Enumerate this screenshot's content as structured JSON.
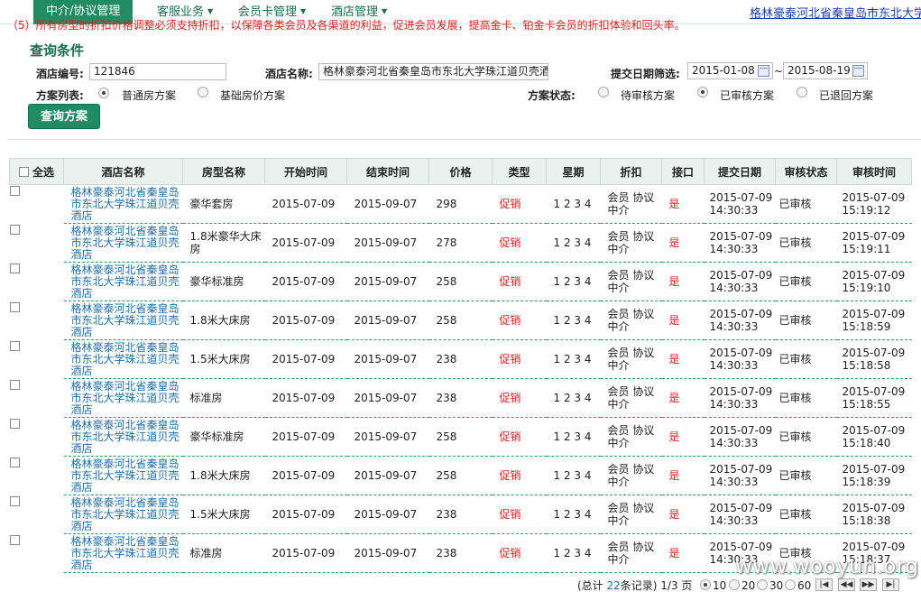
{
  "nav": {
    "items": [
      {
        "label": "中介/协议管理",
        "active": true
      },
      {
        "label": "客服业务",
        "active": false
      },
      {
        "label": "会员卡管理",
        "active": false
      },
      {
        "label": "酒店管理",
        "active": false
      }
    ],
    "hotel_link": "格林豪泰河北省秦皇岛市东北大学珠江道贝壳酒店"
  },
  "notice": "（5）所有房型的折扣价格调整必须支持折扣，以保障各类会员及各渠道的利益，促进会员发展，提高金卡、铂金卡会员的折扣体验和回头率。",
  "query": {
    "title": "查询条件",
    "hotel_no_label": "酒店编号:",
    "hotel_no_value": "121846",
    "hotel_name_label": "酒店名称:",
    "hotel_name_value": "格林豪泰河北省秦皇岛市东北大学珠江道贝壳酒店",
    "date_label": "提交日期筛选:",
    "date_from": "2015-01-08",
    "date_sep": "~",
    "date_to": "2015-08-19",
    "plan_list_label": "方案列表:",
    "plan_options": [
      "普通房方案",
      "基础房价方案"
    ],
    "plan_selected": 0,
    "status_label": "方案状态:",
    "status_options": [
      "待审核方案",
      "已审核方案",
      "已退回方案"
    ],
    "status_selected": 1,
    "button": "查询方案"
  },
  "table": {
    "select_all": "全选",
    "headers": [
      "酒店名称",
      "房型名称",
      "开始时间",
      "结束时间",
      "价格",
      "类型",
      "星期",
      "折扣",
      "接口",
      "提交日期",
      "审核状态",
      "审核时间"
    ],
    "rows": [
      {
        "hotel": "格林豪泰河北省秦皇岛市东北大学珠江道贝壳酒店",
        "room": "豪华套房",
        "start": "2015-07-09",
        "end": "2015-09-07",
        "price": "298",
        "type": "促销",
        "week": "1 2 3 4",
        "discount": "会员 协议 中介",
        "iface": "是",
        "submit": "2015-07-09 14:30:33",
        "status": "已审核",
        "audit": "2015-07-09 15:19:12"
      },
      {
        "hotel": "格林豪泰河北省秦皇岛市东北大学珠江道贝壳酒店",
        "room": "1.8米豪华大床房",
        "start": "2015-07-09",
        "end": "2015-09-07",
        "price": "278",
        "type": "促销",
        "week": "1 2 3 4",
        "discount": "会员 协议 中介",
        "iface": "是",
        "submit": "2015-07-09 14:30:33",
        "status": "已审核",
        "audit": "2015-07-09 15:19:11"
      },
      {
        "hotel": "格林豪泰河北省秦皇岛市东北大学珠江道贝壳酒店",
        "room": "豪华标准房",
        "start": "2015-07-09",
        "end": "2015-09-07",
        "price": "258",
        "type": "促销",
        "week": "1 2 3 4",
        "discount": "会员 协议 中介",
        "iface": "是",
        "submit": "2015-07-09 14:30:33",
        "status": "已审核",
        "audit": "2015-07-09 15:19:10"
      },
      {
        "hotel": "格林豪泰河北省秦皇岛市东北大学珠江道贝壳酒店",
        "room": "1.8米大床房",
        "start": "2015-07-09",
        "end": "2015-09-07",
        "price": "258",
        "type": "促销",
        "week": "1 2 3 4",
        "discount": "会员 协议 中介",
        "iface": "是",
        "submit": "2015-07-09 14:30:33",
        "status": "已审核",
        "audit": "2015-07-09 15:18:59"
      },
      {
        "hotel": "格林豪泰河北省秦皇岛市东北大学珠江道贝壳酒店",
        "room": "1.5米大床房",
        "start": "2015-07-09",
        "end": "2015-09-07",
        "price": "238",
        "type": "促销",
        "week": "1 2 3 4",
        "discount": "会员 协议 中介",
        "iface": "是",
        "submit": "2015-07-09 14:30:33",
        "status": "已审核",
        "audit": "2015-07-09 15:18:58"
      },
      {
        "hotel": "格林豪泰河北省秦皇岛市东北大学珠江道贝壳酒店",
        "room": "标准房",
        "start": "2015-07-09",
        "end": "2015-09-07",
        "price": "238",
        "type": "促销",
        "week": "1 2 3 4",
        "discount": "会员 协议 中介",
        "iface": "是",
        "submit": "2015-07-09 14:30:33",
        "status": "已审核",
        "audit": "2015-07-09 15:18:55"
      },
      {
        "hotel": "格林豪泰河北省秦皇岛市东北大学珠江道贝壳酒店",
        "room": "豪华标准房",
        "start": "2015-07-09",
        "end": "2015-09-07",
        "price": "258",
        "type": "促销",
        "week": "1 2 3 4",
        "discount": "会员 协议 中介",
        "iface": "是",
        "submit": "2015-07-09 14:30:33",
        "status": "已审核",
        "audit": "2015-07-09 15:18:40"
      },
      {
        "hotel": "格林豪泰河北省秦皇岛市东北大学珠江道贝壳酒店",
        "room": "1.8米大床房",
        "start": "2015-07-09",
        "end": "2015-09-07",
        "price": "258",
        "type": "促销",
        "week": "1 2 3 4",
        "discount": "会员 协议 中介",
        "iface": "是",
        "submit": "2015-07-09 14:30:33",
        "status": "已审核",
        "audit": "2015-07-09 15:18:39"
      },
      {
        "hotel": "格林豪泰河北省秦皇岛市东北大学珠江道贝壳酒店",
        "room": "1.5米大床房",
        "start": "2015-07-09",
        "end": "2015-09-07",
        "price": "238",
        "type": "促销",
        "week": "1 2 3 4",
        "discount": "会员 协议 中介",
        "iface": "是",
        "submit": "2015-07-09 14:30:33",
        "status": "已审核",
        "audit": "2015-07-09 15:18:38"
      },
      {
        "hotel": "格林豪泰河北省秦皇岛市东北大学珠江道贝壳酒店",
        "room": "标准房",
        "start": "2015-07-09",
        "end": "2015-09-07",
        "price": "238",
        "type": "促销",
        "week": "1 2 3 4",
        "discount": "会员 协议 中介",
        "iface": "是",
        "submit": "2015-07-09 14:30:33",
        "status": "已审核",
        "audit": "2015-07-09 15:18:37"
      }
    ]
  },
  "footer": {
    "total_prefix": "(总计 ",
    "total_count": "22",
    "total_suffix": "条记录) 1/3 页",
    "page_sizes": [
      "10",
      "20",
      "30",
      "60"
    ],
    "page_size_selected": 0,
    "nav_icons": [
      "first-page-icon",
      "prev-page-icon",
      "next-page-icon",
      "last-page-icon"
    ]
  },
  "watermark": "www.wooyun.org"
}
